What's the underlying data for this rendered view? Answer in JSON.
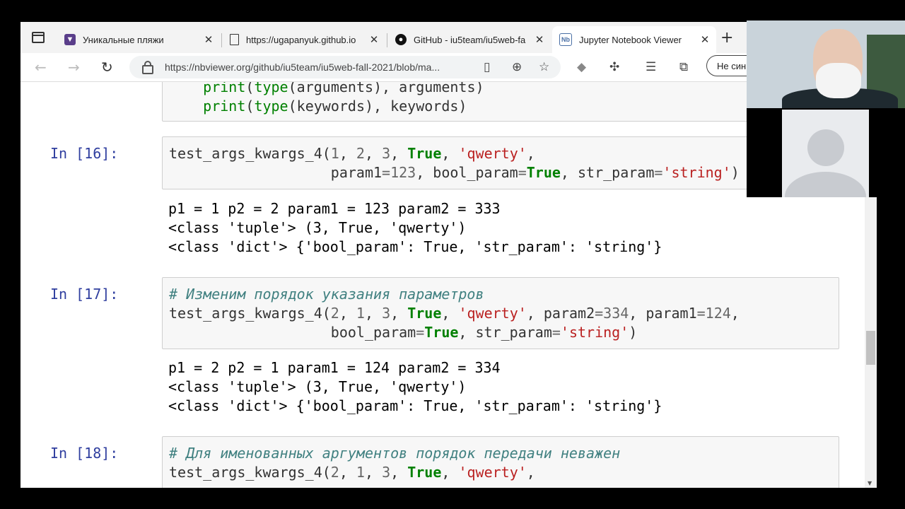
{
  "tabs": [
    {
      "title": "Уникальные пляжи",
      "favicon": "user-shield-icon"
    },
    {
      "title": "https://ugapanyuk.github.io",
      "favicon": "document-icon"
    },
    {
      "title": "GitHub - iu5team/iu5web-fa",
      "favicon": "github-icon"
    },
    {
      "title": "Jupyter Notebook Viewer",
      "favicon": "nbviewer-icon",
      "active": true
    }
  ],
  "url": "https://nbviewer.org/github/iu5team/iu5web-fall-2021/blob/ma...",
  "profile_label": "Не син",
  "cells": {
    "c16": {
      "prompt": "In [16]:",
      "out": [
        "p1 = 1 p2 = 2 param1 = 123 param2 = 333",
        "<class 'tuple'> (3, True, 'qwerty')",
        "<class 'dict'> {'bool_param': True, 'str_param': 'string'}"
      ]
    },
    "c17": {
      "prompt": "In [17]:",
      "comment": "# Изменим порядок указания параметров",
      "out": [
        "p1 = 2 p2 = 1 param1 = 124 param2 = 334",
        "<class 'tuple'> (3, True, 'qwerty')",
        "<class 'dict'> {'bool_param': True, 'str_param': 'string'}"
      ]
    },
    "c18": {
      "prompt": "In [18]:",
      "comment": "# Для именованных аргументов порядок передачи неважен"
    }
  }
}
